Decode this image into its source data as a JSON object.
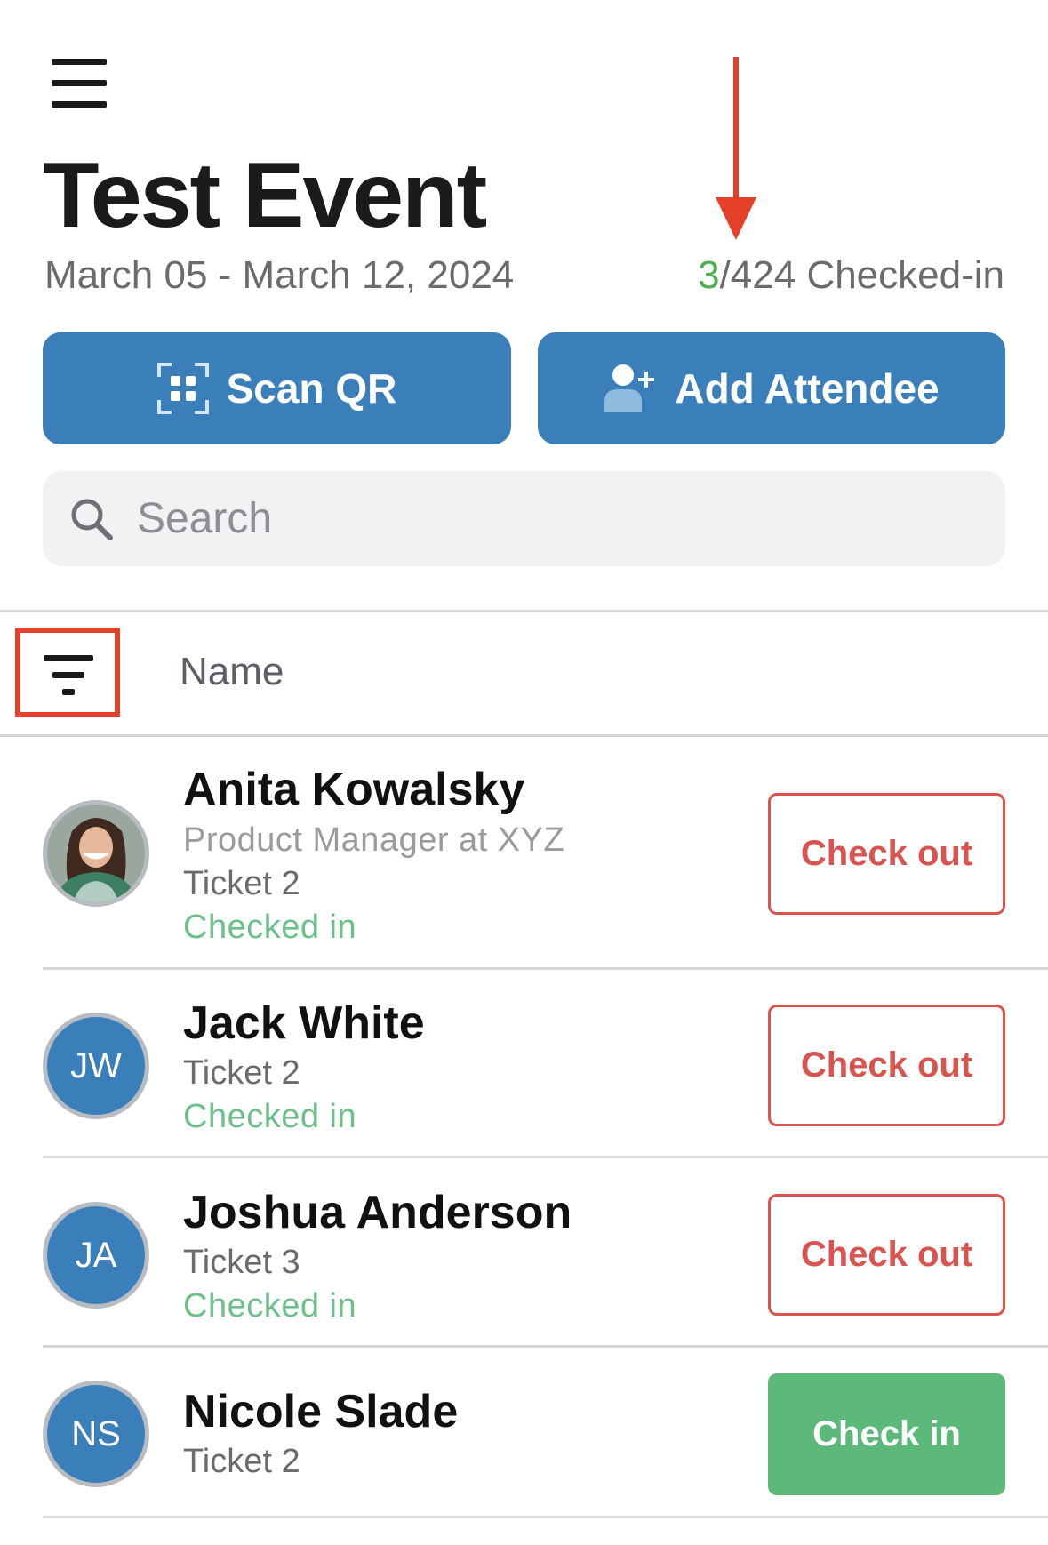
{
  "event": {
    "title": "Test Event",
    "dates": "March 05 - March 12, 2024",
    "checked_count": "3",
    "total_label": "/424 Checked-in"
  },
  "actions": {
    "scan_label": "Scan QR",
    "add_label": "Add Attendee"
  },
  "search": {
    "placeholder": "Search",
    "value": ""
  },
  "list_header": {
    "column": "Name"
  },
  "attendees": [
    {
      "name": "Anita Kowalsky",
      "subtitle": "Product Manager at XYZ",
      "ticket": "Ticket 2",
      "status": "Checked in",
      "button": "Check out",
      "initials": ""
    },
    {
      "name": "Jack White",
      "ticket": "Ticket 2",
      "status": "Checked in",
      "button": "Check out",
      "initials": "JW"
    },
    {
      "name": "Joshua Anderson",
      "ticket": "Ticket 3",
      "status": "Checked in",
      "button": "Check out",
      "initials": "JA"
    },
    {
      "name": "Nicole Slade",
      "ticket": "Ticket 2",
      "status": "",
      "button": "Check in",
      "initials": "NS"
    }
  ],
  "colors": {
    "primary": "#3b7fba",
    "checked_in_green": "#5cb979",
    "checkout_red": "#d9534f",
    "annotation_red": "#e5402a",
    "count_green": "#4caf50"
  },
  "icons": [
    "menu-icon",
    "qr-scan-icon",
    "add-person-icon",
    "search-icon",
    "filter-icon"
  ]
}
